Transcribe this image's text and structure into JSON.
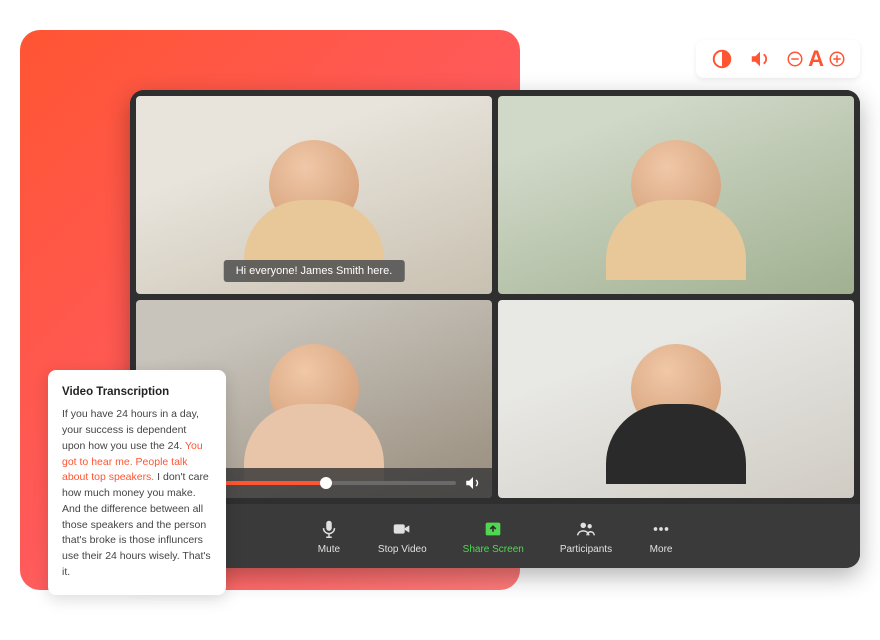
{
  "accessibility": {
    "contrast_icon": "contrast-icon",
    "audio_icon": "speaker-icon",
    "minus_icon": "minus-icon",
    "letter": "A",
    "plus_icon": "plus-icon"
  },
  "video_tiles": {
    "tile1_caption": "Hi everyone! James Smith here."
  },
  "toolbar": {
    "mute_label": "Mute",
    "stop_video_label": "Stop Video",
    "share_screen_label": "Share Screen",
    "participants_label": "Participants",
    "more_label": "More"
  },
  "transcription": {
    "title": "Video Transcription",
    "body1": "If you have 24 hours in a day, your success is dependent upon how you use the 24.",
    "highlight": "You got to hear me. People talk about top speakers.",
    "body2": "I don't care how much money you make. And the difference between all those speakers and the person that's broke is those influncers use their 24 hours wisely. That's it."
  }
}
